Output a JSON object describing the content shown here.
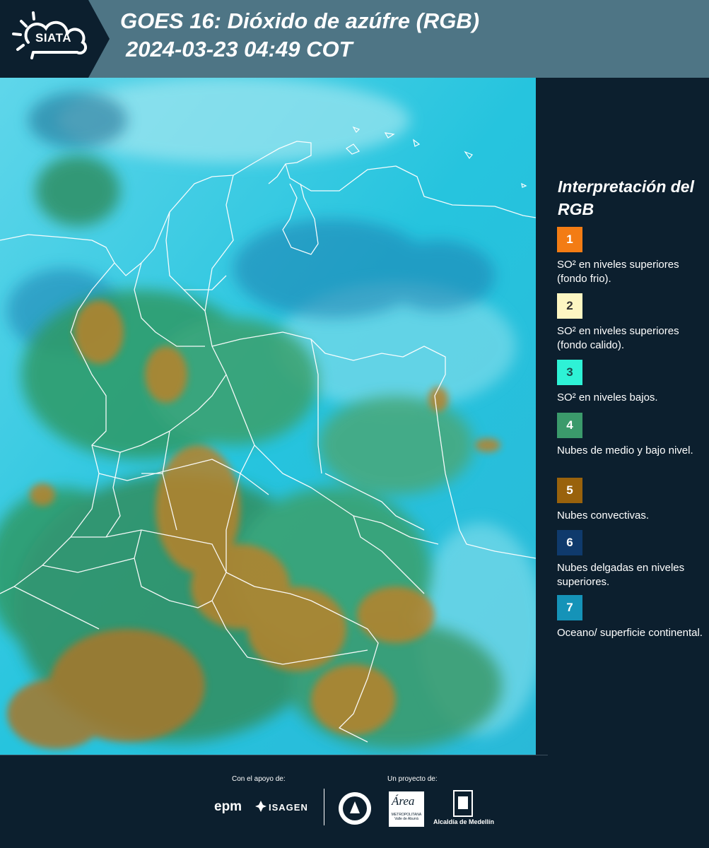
{
  "header": {
    "logo": "SIATA",
    "title_line1": "GOES 16: Dióxido de azúfre (RGB)",
    "title_line2": "2024-03-23 04:49 COT",
    "background_color": "#4e7585"
  },
  "legend": {
    "title": "Interpretación del RGB",
    "items": [
      {
        "number": "1",
        "label": "SO² en niveles superiores (fondo frio).",
        "color": "#f37c14"
      },
      {
        "number": "2",
        "label": "SO² en niveles superiores (fondo calido).",
        "color": "#fdf6c2"
      },
      {
        "number": "3",
        "label": "SO² en niveles bajos.",
        "color": "#2ef2d6"
      },
      {
        "number": "4",
        "label": "Nubes de medio y bajo nivel.",
        "color": "#3b9a6b"
      },
      {
        "number": "5",
        "label": "Nubes convectivas.",
        "color": "#99620c"
      },
      {
        "number": "6",
        "label": "Nubes delgadas en niveles superiores.",
        "color": "#0f3a6c"
      },
      {
        "number": "7",
        "label": "Oceano/ superficie continental.",
        "color": "#1593b8"
      }
    ]
  },
  "footer": {
    "support_label": "Con el apoyo de:",
    "project_label": "Un proyecto de:",
    "sponsors": [
      "epm",
      "ISAGEN"
    ],
    "area_logo": {
      "name": "Área",
      "subtitle": "METROPOLITANA Valle de Aburrá"
    },
    "alcaldia": "Alcaldía de Medellín"
  },
  "map": {
    "icons": [
      "satellite-image",
      "colombia-boundaries"
    ]
  }
}
